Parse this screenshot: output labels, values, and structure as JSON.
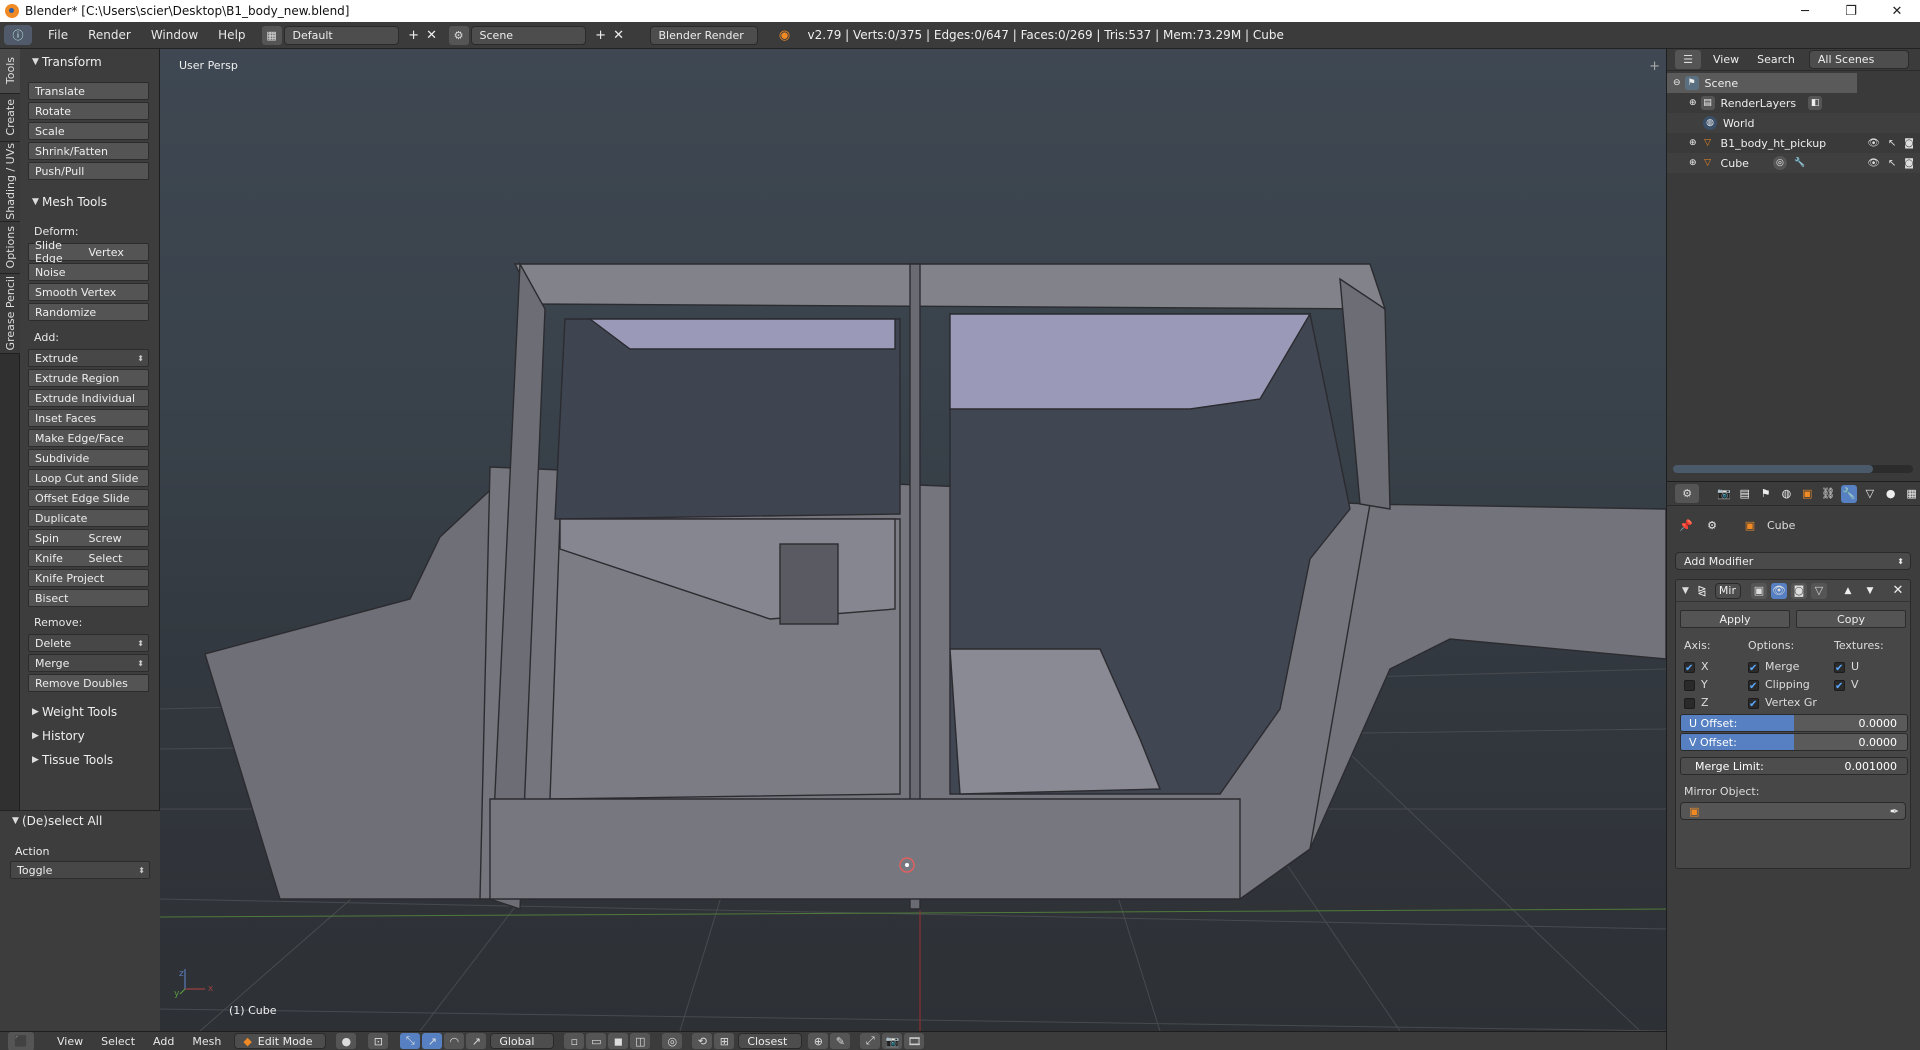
{
  "window": {
    "title": "Blender* [C:\\Users\\scier\\Desktop\\B1_body_new.blend]",
    "controls": [
      "─",
      "❐",
      "✕"
    ]
  },
  "info_header": {
    "menus": [
      "File",
      "Render",
      "Window",
      "Help"
    ],
    "screen_layout": "Default",
    "scene": "Scene",
    "render_engine": "Blender Render",
    "stats": "v2.79 | Verts:0/375 | Edges:0/647 | Faces:0/269 | Tris:537 | Mem:73.29M | Cube"
  },
  "vertical_tabs": [
    "Tools",
    "Create",
    "Shading / UVs",
    "Options",
    "Grease Pencil"
  ],
  "tool_shelf": {
    "transform": {
      "title": "Transform",
      "buttons": [
        "Translate",
        "Rotate",
        "Scale",
        "Shrink/Fatten",
        "Push/Pull"
      ]
    },
    "mesh_tools": {
      "title": "Mesh Tools",
      "deform_label": "Deform:",
      "slide_edge": "Slide Edge",
      "vertex": "Vertex",
      "deform_buttons": [
        "Noise",
        "Smooth Vertex",
        "Randomize"
      ],
      "add_label": "Add:",
      "extrude": "Extrude",
      "add_buttons": [
        "Extrude Region",
        "Extrude Individual",
        "Inset Faces",
        "Make Edge/Face",
        "Subdivide",
        "Loop Cut and Slide",
        "Offset Edge Slide",
        "Duplicate"
      ],
      "spin": "Spin",
      "screw": "Screw",
      "knife": "Knife",
      "select": "Select",
      "knife_project": "Knife Project",
      "bisect": "Bisect",
      "remove_label": "Remove:",
      "delete": "Delete",
      "merge": "Merge",
      "remove_doubles": "Remove Doubles"
    },
    "collapsed_panels": [
      "Weight Tools",
      "History",
      "Tissue Tools"
    ]
  },
  "operator_panel": {
    "title": "(De)select All",
    "action_label": "Action",
    "action_value": "Toggle"
  },
  "viewport": {
    "view_label": "User Persp",
    "object_label": "(1) Cube",
    "axes": {
      "x": "x",
      "y": "y",
      "z": "z"
    }
  },
  "bottom_header": {
    "menus": [
      "View",
      "Select",
      "Add",
      "Mesh"
    ],
    "mode": "Edit Mode",
    "orientation": "Global",
    "snap": "Closest"
  },
  "outliner": {
    "menus": [
      "View",
      "Search"
    ],
    "filter": "All Scenes",
    "items": [
      {
        "label": "Scene",
        "icon": "scene-icon"
      },
      {
        "label": "RenderLayers",
        "icon": "renderlayers-icon"
      },
      {
        "label": "World",
        "icon": "world-icon"
      },
      {
        "label": "B1_body_ht_pickup",
        "icon": "mesh-object-icon"
      },
      {
        "label": "Cube",
        "icon": "mesh-object-icon"
      }
    ]
  },
  "properties": {
    "object_name": "Cube",
    "add_modifier": "Add Modifier",
    "modifier": {
      "name_short": "Mir",
      "apply": "Apply",
      "copy": "Copy",
      "axis_label": "Axis:",
      "options_label": "Options:",
      "textures_label": "Textures:",
      "axes": [
        {
          "label": "X",
          "checked": true
        },
        {
          "label": "Y",
          "checked": false
        },
        {
          "label": "Z",
          "checked": false
        }
      ],
      "options": [
        {
          "label": "Merge",
          "checked": true
        },
        {
          "label": "Clipping",
          "checked": true
        },
        {
          "label": "Vertex Gr",
          "checked": true
        }
      ],
      "textures": [
        {
          "label": "U",
          "checked": true
        },
        {
          "label": "V",
          "checked": true
        }
      ],
      "u_offset_label": "U Offset:",
      "u_offset": "0.0000",
      "v_offset_label": "V Offset:",
      "v_offset": "0.0000",
      "merge_limit_label": "Merge Limit:",
      "merge_limit": "0.001000",
      "mirror_object_label": "Mirror Object:"
    }
  },
  "colors": {
    "accent_blue": "#5680c2",
    "orange_icon": "#f08a24",
    "viewport_top": "#3f4852",
    "mesh_face": "#7a7a82"
  }
}
